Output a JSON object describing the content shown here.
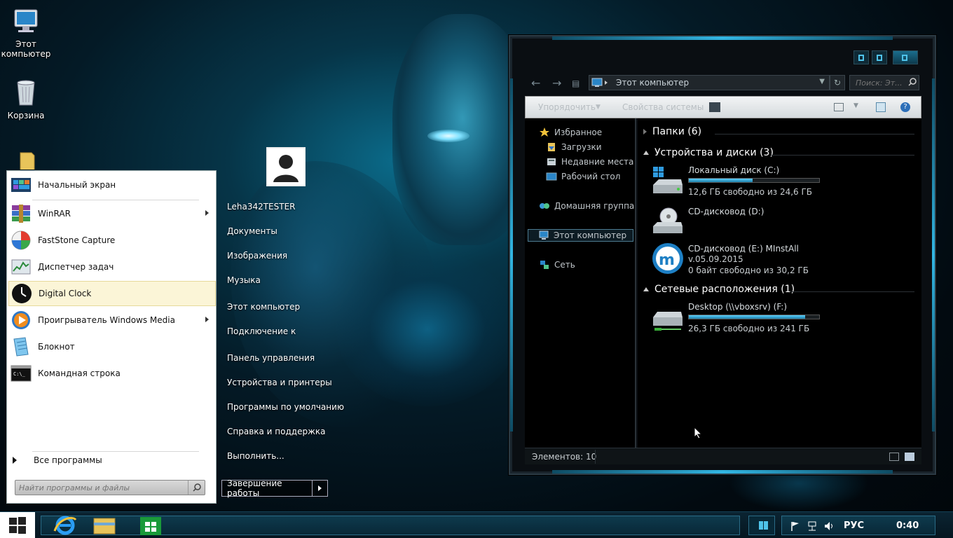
{
  "desktop": {
    "icons": [
      {
        "label_line1": "Этот",
        "label_line2": "компьютер"
      },
      {
        "label_line1": "Корзина",
        "label_line2": ""
      }
    ]
  },
  "start_menu": {
    "items": [
      {
        "label": "Начальный экран",
        "icon": "start-screen-icon",
        "submenu": false
      },
      {
        "label": "WinRAR",
        "icon": "winrar-icon",
        "submenu": true
      },
      {
        "label": "FastStone Capture",
        "icon": "faststone-icon",
        "submenu": false
      },
      {
        "label": "Диспетчер задач",
        "icon": "task-manager-icon",
        "submenu": false
      },
      {
        "label": "Digital Clock",
        "icon": "clock-icon",
        "submenu": false,
        "selected": true
      },
      {
        "label": "Проигрыватель Windows Media",
        "icon": "media-player-icon",
        "submenu": true
      },
      {
        "label": "Блокнот",
        "icon": "notepad-icon",
        "submenu": false
      },
      {
        "label": "Командная строка",
        "icon": "command-prompt-icon",
        "submenu": false
      }
    ],
    "all_programs": "Все программы",
    "search_placeholder": "Найти программы и файлы",
    "user_name": "Leha342TESTER",
    "right_items": [
      "Документы",
      "Изображения",
      "Музыка",
      "Этот компьютер",
      "Подключение к",
      "Панель управления",
      "Устройства и принтеры",
      "Программы по умолчанию",
      "Справка и поддержка",
      "Выполнить..."
    ],
    "shutdown": "Завершение работы"
  },
  "explorer": {
    "address": "Этот компьютер",
    "search_placeholder": "Поиск: Эт...",
    "toolbar": {
      "organize": "Упорядочить",
      "system_properties": "Свойства системы"
    },
    "nav": {
      "favorites": "Избранное",
      "downloads": "Загрузки",
      "recent": "Недавние места",
      "desktop": "Рабочий стол",
      "homegroup": "Домашняя группа",
      "this_pc": "Этот компьютер",
      "network": "Сеть"
    },
    "groups": {
      "folders": "Папки (6)",
      "devices": "Устройства и диски (3)",
      "network": "Сетевые расположения (1)"
    },
    "drives": [
      {
        "name": "Локальный диск (C:)",
        "free": "12,6 ГБ свободно из 24,6 ГБ",
        "used_fraction": 0.49
      },
      {
        "name": "CD-дисковод (D:)"
      },
      {
        "name": "CD-дисковод (E:) MInstAll",
        "line2": "v.05.09.2015",
        "free": "0 байт свободно из 30,2 ГБ"
      },
      {
        "name": "Desktop (\\\\vboxsrv) (F:)",
        "free": "26,3 ГБ свободно из 241 ГБ",
        "used_fraction": 0.89
      }
    ],
    "status": "Элементов: 10"
  },
  "taskbar": {
    "language": "РУС",
    "clock": "0:40"
  },
  "colors": {
    "accent": "#32b6e3",
    "selection": "#fbf5d7"
  }
}
